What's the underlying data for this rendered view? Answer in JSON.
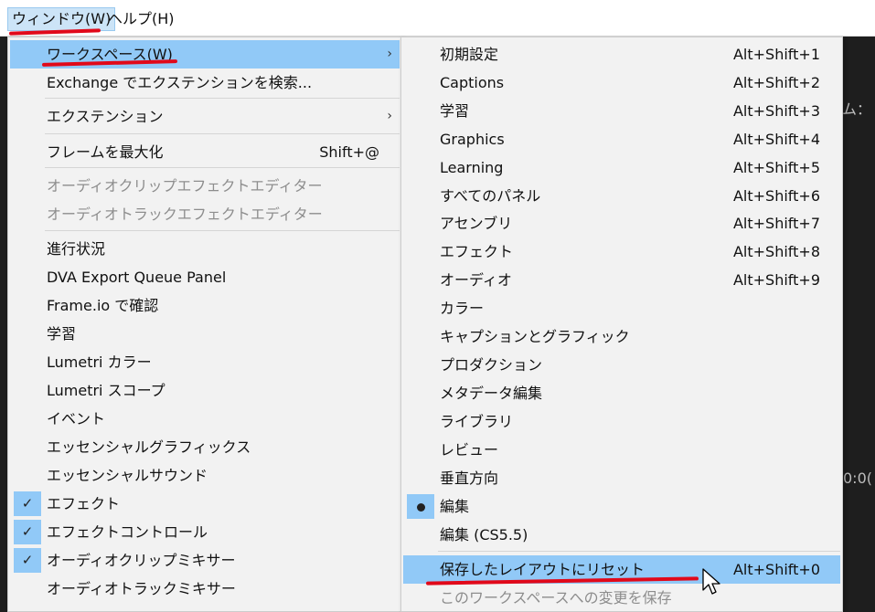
{
  "menubar": {
    "window_label": "ウィンドウ(W)",
    "help_label": "ヘルプ(H)"
  },
  "background": {
    "fragment_right": "ム：",
    "fragment_time": "0:0("
  },
  "window_menu": {
    "items": [
      {
        "label": "ワークスペース(W)",
        "shortcut": "",
        "submenu": true
      },
      {
        "label": "Exchange でエクステンションを検索...",
        "shortcut": ""
      },
      {
        "label": "エクステンション",
        "shortcut": "",
        "submenu": true
      },
      {
        "label": "フレームを最大化",
        "shortcut": "Shift+@"
      },
      {
        "label": "オーディオクリップエフェクトエディター",
        "shortcut": "",
        "disabled": true
      },
      {
        "label": "オーディオトラックエフェクトエディター",
        "shortcut": "",
        "disabled": true
      },
      {
        "label": "進行状況",
        "shortcut": ""
      },
      {
        "label": "DVA Export Queue Panel",
        "shortcut": ""
      },
      {
        "label": "Frame.io で確認",
        "shortcut": ""
      },
      {
        "label": "学習",
        "shortcut": ""
      },
      {
        "label": "Lumetri カラー",
        "shortcut": ""
      },
      {
        "label": "Lumetri スコープ",
        "shortcut": ""
      },
      {
        "label": "イベント",
        "shortcut": ""
      },
      {
        "label": "エッセンシャルグラフィックス",
        "shortcut": ""
      },
      {
        "label": "エッセンシャルサウンド",
        "shortcut": ""
      },
      {
        "label": "エフェクト",
        "shortcut": "",
        "checked": true
      },
      {
        "label": "エフェクトコントロール",
        "shortcut": "",
        "checked": true
      },
      {
        "label": "オーディオクリップミキサー",
        "shortcut": "",
        "checked": true
      },
      {
        "label": "オーディオトラックミキサー",
        "shortcut": ""
      }
    ],
    "check_glyph": "✓",
    "submenu_glyph": "›"
  },
  "workspace_menu": {
    "items": [
      {
        "label": "初期設定",
        "shortcut": "Alt+Shift+1"
      },
      {
        "label": "Captions",
        "shortcut": "Alt+Shift+2"
      },
      {
        "label": "学習",
        "shortcut": "Alt+Shift+3"
      },
      {
        "label": "Graphics",
        "shortcut": "Alt+Shift+4"
      },
      {
        "label": "Learning",
        "shortcut": "Alt+Shift+5"
      },
      {
        "label": "すべてのパネル",
        "shortcut": "Alt+Shift+6"
      },
      {
        "label": "アセンブリ",
        "shortcut": "Alt+Shift+7"
      },
      {
        "label": "エフェクト",
        "shortcut": "Alt+Shift+8"
      },
      {
        "label": "オーディオ",
        "shortcut": "Alt+Shift+9"
      },
      {
        "label": "カラー",
        "shortcut": ""
      },
      {
        "label": "キャプションとグラフィック",
        "shortcut": ""
      },
      {
        "label": "プロダクション",
        "shortcut": ""
      },
      {
        "label": "メタデータ編集",
        "shortcut": ""
      },
      {
        "label": "ライブラリ",
        "shortcut": ""
      },
      {
        "label": "レビュー",
        "shortcut": ""
      },
      {
        "label": "垂直方向",
        "shortcut": ""
      },
      {
        "label": "編集",
        "shortcut": "",
        "selected": true
      },
      {
        "label": "編集 (CS5.5)",
        "shortcut": ""
      },
      {
        "label": "保存したレイアウトにリセット",
        "shortcut": "Alt+Shift+0",
        "highlighted": true
      },
      {
        "label": "このワークスペースへの変更を保存",
        "shortcut": "",
        "disabled": true
      }
    ]
  },
  "colors": {
    "highlight": "#91c9f7",
    "annotation_red": "#e1091a",
    "menu_bg": "#f2f2f2"
  }
}
